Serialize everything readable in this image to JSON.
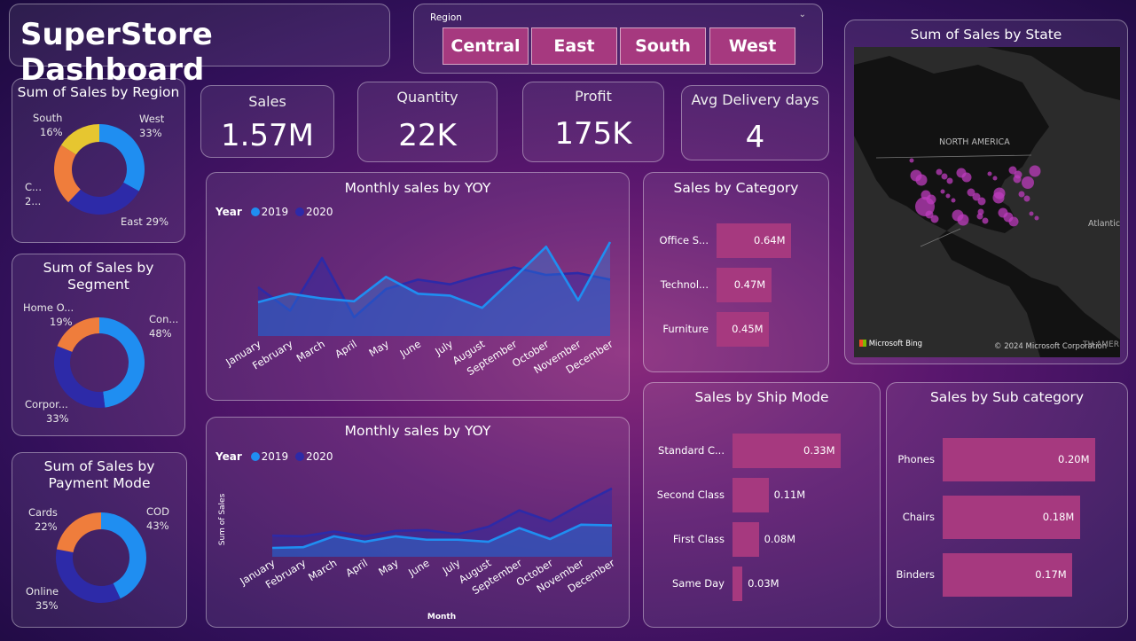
{
  "title": "SuperStore Dashboard",
  "slicer": {
    "label": "Region",
    "options": [
      "Central",
      "East",
      "South",
      "West"
    ]
  },
  "kpis": {
    "sales": {
      "label": "Sales",
      "value": "1.57M"
    },
    "quantity": {
      "label": "Quantity",
      "value": "22K"
    },
    "profit": {
      "label": "Profit",
      "value": "175K"
    },
    "delivery": {
      "label": "Avg Delivery days",
      "value": "4"
    }
  },
  "colors": {
    "y2019": "#1f8ef1",
    "y2020": "#2d2aa8",
    "orange": "#ef7d3c",
    "yellow": "#e6c630",
    "bar": "#a6397f"
  },
  "region_chart": {
    "title": "Sum of Sales by Region",
    "labels": {
      "west": "West",
      "west_pct": "33%",
      "east": "East 29%",
      "central": "C...",
      "central_pct": "2...",
      "south": "South",
      "south_pct": "16%"
    }
  },
  "segment_chart": {
    "title1": "Sum of Sales by",
    "title2": "Segment",
    "labels": {
      "con": "Con...",
      "con_pct": "48%",
      "home": "Home O...",
      "home_pct": "19%",
      "corp": "Corpor...",
      "corp_pct": "33%"
    }
  },
  "payment_chart": {
    "title1": "Sum of Sales by",
    "title2": "Payment Mode",
    "labels": {
      "cod": "COD",
      "cod_pct": "43%",
      "cards": "Cards",
      "cards_pct": "22%",
      "online": "Online",
      "online_pct": "35%"
    }
  },
  "yoy1": {
    "title": "Monthly sales by YOY",
    "legend_title": "Year",
    "s1": "2019",
    "s2": "2020"
  },
  "yoy2": {
    "title": "Monthly sales by YOY",
    "legend_title": "Year",
    "s1": "2019",
    "s2": "2020",
    "ylabel": "Sum of Sales",
    "xlabel": "Month"
  },
  "months": [
    "January",
    "February",
    "March",
    "April",
    "May",
    "June",
    "July",
    "August",
    "September",
    "October",
    "November",
    "December"
  ],
  "category": {
    "title": "Sales by Category",
    "items": [
      {
        "name": "Office S...",
        "value": "0.64M"
      },
      {
        "name": "Technol...",
        "value": "0.47M"
      },
      {
        "name": "Furniture",
        "value": "0.45M"
      }
    ]
  },
  "shipmode": {
    "title": "Sales by Ship Mode",
    "items": [
      {
        "name": "Standard C...",
        "value": "0.33M"
      },
      {
        "name": "Second Class",
        "value": "0.11M"
      },
      {
        "name": "First Class",
        "value": "0.08M"
      },
      {
        "name": "Same Day",
        "value": "0.03M"
      }
    ]
  },
  "subcat": {
    "title": "Sales by Sub category",
    "items": [
      {
        "name": "Phones",
        "value": "0.20M"
      },
      {
        "name": "Chairs",
        "value": "0.18M"
      },
      {
        "name": "Binders",
        "value": "0.17M"
      }
    ]
  },
  "map": {
    "title": "Sum of Sales by State",
    "continent": "NORTH AMERICA",
    "ocean": "Atlantic",
    "credit_left": "Microsoft Bing",
    "credit_right": "© 2024 Microsoft Corporation",
    "credit_cut": "TH AMER"
  },
  "chart_data": [
    {
      "type": "area",
      "title": "Monthly sales by YOY",
      "categories": [
        "January",
        "February",
        "March",
        "April",
        "May",
        "June",
        "July",
        "August",
        "September",
        "October",
        "November",
        "December"
      ],
      "series": [
        {
          "name": "2019",
          "values": [
            0.36,
            0.45,
            0.4,
            0.37,
            0.63,
            0.45,
            0.43,
            0.3,
            0.62,
            0.95,
            0.38,
            1.0
          ]
        },
        {
          "name": "2020",
          "values": [
            0.52,
            0.27,
            0.83,
            0.2,
            0.5,
            0.6,
            0.55,
            0.65,
            0.73,
            0.65,
            0.67,
            0.6
          ]
        }
      ]
    },
    {
      "type": "area",
      "title": "Monthly sales by YOY",
      "xlabel": "Month",
      "ylabel": "Sum of Sales",
      "categories": [
        "January",
        "February",
        "March",
        "April",
        "May",
        "June",
        "July",
        "August",
        "September",
        "October",
        "November",
        "December"
      ],
      "series": [
        {
          "name": "2019",
          "values": [
            0.13,
            0.14,
            0.3,
            0.22,
            0.3,
            0.25,
            0.25,
            0.22,
            0.42,
            0.26,
            0.47,
            0.46
          ]
        },
        {
          "name": "2020",
          "values": [
            0.31,
            0.3,
            0.37,
            0.3,
            0.38,
            0.39,
            0.33,
            0.44,
            0.68,
            0.52,
            0.77,
            1.0
          ]
        }
      ]
    },
    {
      "type": "pie",
      "title": "Sum of Sales by Region",
      "labels": [
        "West",
        "East",
        "Central",
        "South"
      ],
      "values": [
        33,
        29,
        22,
        16
      ]
    },
    {
      "type": "pie",
      "title": "Sum of Sales by Segment",
      "labels": [
        "Con...",
        "Corpor...",
        "Home O..."
      ],
      "values": [
        48,
        33,
        19
      ]
    },
    {
      "type": "pie",
      "title": "Sum of Sales by Payment Mode",
      "labels": [
        "COD",
        "Online",
        "Cards"
      ],
      "values": [
        43,
        35,
        22
      ]
    },
    {
      "type": "bar",
      "title": "Sales by Category",
      "categories": [
        "Office S...",
        "Technol...",
        "Furniture"
      ],
      "values": [
        0.64,
        0.47,
        0.45
      ]
    },
    {
      "type": "bar",
      "title": "Sales by Ship Mode",
      "categories": [
        "Standard C...",
        "Second Class",
        "First Class",
        "Same Day"
      ],
      "values": [
        0.33,
        0.11,
        0.08,
        0.03
      ]
    },
    {
      "type": "bar",
      "title": "Sales by Sub category",
      "categories": [
        "Phones",
        "Chairs",
        "Binders"
      ],
      "values": [
        0.2,
        0.18,
        0.17
      ]
    }
  ]
}
